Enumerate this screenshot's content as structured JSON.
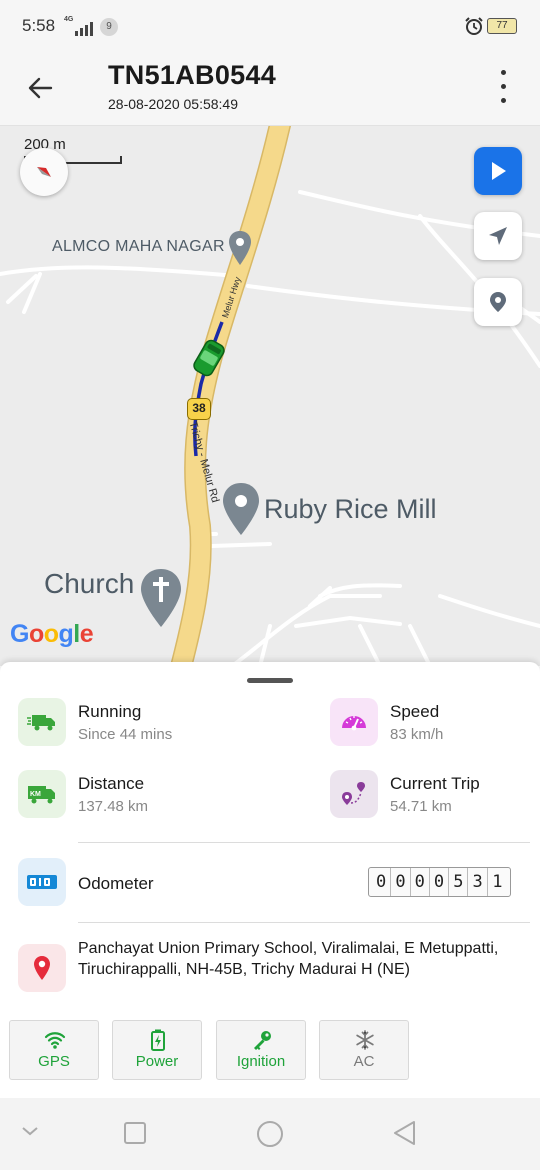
{
  "status_bar": {
    "time": "5:58",
    "network_label": "4G",
    "notification_count": "9",
    "battery": "77",
    "icons": [
      "signal-icon",
      "alarm-icon",
      "battery-icon"
    ]
  },
  "app_bar": {
    "title": "TN51AB0544",
    "subtitle": "28-08-2020 05:58:49",
    "icons": [
      "back-arrow-icon",
      "more-vert-icon"
    ]
  },
  "map": {
    "scale_label": "200 m",
    "pois": {
      "almco": "ALMCO MAHA NAGAR",
      "ruby": "Ruby Rice Mill",
      "church": "Church"
    },
    "road_name": "Trichy - Melur Rd",
    "road_name_partial": "Melur Hwy",
    "route_shield": "38",
    "google_logo": [
      "G",
      "o",
      "o",
      "g",
      "l",
      "e"
    ],
    "controls": [
      "play-icon",
      "navigation-arrow-icon",
      "location-pin-icon",
      "compass-icon"
    ]
  },
  "stats": {
    "running": {
      "title": "Running",
      "value": "Since 44 mins"
    },
    "speed": {
      "title": "Speed",
      "value": "83 km/h"
    },
    "distance": {
      "title": "Distance",
      "value": "137.48 km"
    },
    "current_trip": {
      "title": "Current Trip",
      "value": "54.71 km"
    }
  },
  "odometer": {
    "title": "Odometer",
    "digits": [
      "0",
      "0",
      "0",
      "0",
      "5",
      "3",
      "1"
    ]
  },
  "address": "Panchayat Union Primary School, Viralimalai, E Metuppatti, Tiruchirappalli, NH-45B, Trichy Madurai H (NE)",
  "features": [
    {
      "label": "GPS",
      "icon": "wifi-icon"
    },
    {
      "label": "Power",
      "icon": "battery-charging-icon"
    },
    {
      "label": "Ignition",
      "icon": "key-icon"
    },
    {
      "label": "AC",
      "icon": "snowflake-icon"
    }
  ],
  "colors": {
    "accent_green": "#1fa33a",
    "play_blue": "#1a73e8",
    "road_yellow": "#f5d98b",
    "route_blue": "#1b2aa8",
    "speed_purple": "#d53ad8",
    "location_red": "#e52c3c",
    "odometer_blue": "#1588d6",
    "inactive_gray": "#7a7a7a"
  },
  "nav_bar": {
    "icons": [
      "nav-collapse-icon",
      "nav-recents-icon",
      "nav-home-icon",
      "nav-back-icon"
    ]
  }
}
